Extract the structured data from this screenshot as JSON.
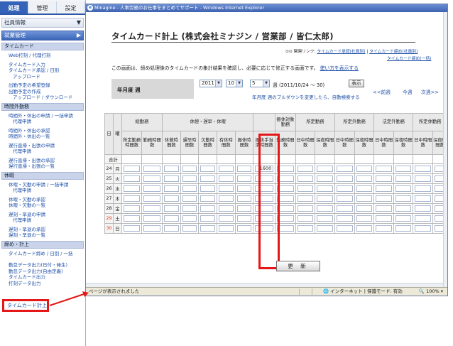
{
  "sidebar": {
    "tabs": [
      "処理",
      "管理",
      "設定"
    ],
    "accordion": [
      {
        "label": "社員情報"
      },
      {
        "label": "就業管理"
      }
    ],
    "sections": [
      {
        "title": "タイムカード",
        "links": [
          {
            "label": "Web打刻 / 代理打刻",
            "indent": false
          },
          {
            "label": "タイムカード入力",
            "indent": false,
            "gap": true
          },
          {
            "label": "タイムカード承認 / 日別",
            "indent": false
          },
          {
            "label": "アップロード",
            "indent": true
          },
          {
            "label": "出勤予定の希望登録",
            "indent": false,
            "gap": true
          },
          {
            "label": "出勤予定の作成",
            "indent": false
          },
          {
            "label": "アップロード / ダウンロード",
            "indent": true
          }
        ]
      },
      {
        "title": "時間外勤務",
        "links": [
          {
            "label": "時間外・休出の申請 / 一括申請",
            "indent": false
          },
          {
            "label": "代理申請",
            "indent": true
          },
          {
            "label": "時間外・休出の承認",
            "indent": false,
            "gap": true
          },
          {
            "label": "時間外・休出の一覧",
            "indent": false
          },
          {
            "label": "遅行直帰・出張の申請",
            "indent": false,
            "gap": true
          },
          {
            "label": "代理申請",
            "indent": true
          },
          {
            "label": "遅行直帰・出張の承認",
            "indent": false,
            "gap": true
          },
          {
            "label": "遅行直帰・出張の一覧",
            "indent": false
          }
        ]
      },
      {
        "title": "休暇",
        "links": [
          {
            "label": "休暇・欠勤の申請 / 一括申請",
            "indent": false
          },
          {
            "label": "代理申請",
            "indent": true
          },
          {
            "label": "休暇・欠勤の承認",
            "indent": false,
            "gap": true
          },
          {
            "label": "休暇・欠勤の一覧",
            "indent": false
          },
          {
            "label": "遅刻・早退の申請",
            "indent": false,
            "gap": true
          },
          {
            "label": "代理申請",
            "indent": true
          },
          {
            "label": "遅刻・早退の承認",
            "indent": false,
            "gap": true
          },
          {
            "label": "遅刻・早退の一覧",
            "indent": false
          }
        ]
      },
      {
        "title": "締め・計上",
        "links": [
          {
            "label": "タイムカード締め / 日別 / 一括",
            "indent": false
          },
          {
            "label": "",
            "indent": false,
            "gap": true
          },
          {
            "label": "勤怠データ出力(日付・発生)",
            "indent": false,
            "gap": true
          },
          {
            "label": "勤怠データ出力(自由定義)",
            "indent": false
          },
          {
            "label": "タイムカード出力",
            "indent": false
          },
          {
            "label": "打刻データ出力",
            "indent": false
          }
        ]
      }
    ],
    "highlighted_link": "タイムカード計上"
  },
  "browser": {
    "window_title": "Minagine - 人事労務のお仕事をまとめてサポート - Windows Internet Explorer",
    "status_text": "ページが表示されました",
    "zone_text": "インターネット | 保護モード: 有効",
    "zoom": "100%"
  },
  "page": {
    "title": "タイムカード計上 (株式会社ミナジン / 営業部 / 皆仁太郎)",
    "related_label": "関連リンク:",
    "related_links": [
      "タイムカード承認(社員別)",
      "タイムカード締め(社員別)",
      "タイムカード締め(一括)"
    ],
    "description": "この画面は、締め処理後のタイムカードの集計結果を確認し、必要に応じて修正する画面です。",
    "help_link": "使い方を表示する",
    "filter": {
      "label": "年月度 週",
      "year": "2011",
      "month": "10",
      "week": "5",
      "week_suffix": "週 (2011/10/24 ～ 30)",
      "show_button": "表示",
      "note": "年月度 週のプルダウンを変更したら、自動検索する",
      "prev": "<<前週",
      "this": "今週",
      "next": "次週>>"
    },
    "table": {
      "day_header": "日",
      "weekday_header": "曜",
      "groups": {
        "total": "総勤務",
        "rest": "休憩・遅早・休暇",
        "furikyu_target": "振休対象勤務",
        "scheduled": "所定勤務",
        "non_scheduled": "所定外勤務",
        "legal_non_scheduled": "法定外勤務",
        "scheduled_holiday": "所定休勤務"
      },
      "sub": {
        "total_hours": "所定勤務時間数",
        "work_hours": "勤務時間数",
        "break": "休憩時間数",
        "late": "遅早時間数",
        "absent": "欠勤時間数",
        "paid": "有休時間数",
        "furikyu": "振休時間数",
        "furikyu_allow": "振休手当清時間数",
        "work": "勤務時間数",
        "day": "日中時間数",
        "night": "深夜時間数"
      },
      "sum_label": "合計",
      "rows": [
        {
          "day": "24",
          "wk": "月",
          "kind": "weekday",
          "value": "1600"
        },
        {
          "day": "25",
          "wk": "火",
          "kind": "weekday",
          "value": ""
        },
        {
          "day": "26",
          "wk": "水",
          "kind": "weekday",
          "value": ""
        },
        {
          "day": "27",
          "wk": "木",
          "kind": "weekday",
          "value": ""
        },
        {
          "day": "28",
          "wk": "金",
          "kind": "weekday",
          "value": ""
        },
        {
          "day": "29",
          "wk": "土",
          "kind": "sat",
          "value": ""
        },
        {
          "day": "30",
          "wk": "日",
          "kind": "sun",
          "value": ""
        }
      ]
    },
    "update_button": "更 新"
  },
  "colors": {
    "accent": "#3563b8",
    "highlight": "#e41818",
    "link": "#1d4fa8"
  }
}
